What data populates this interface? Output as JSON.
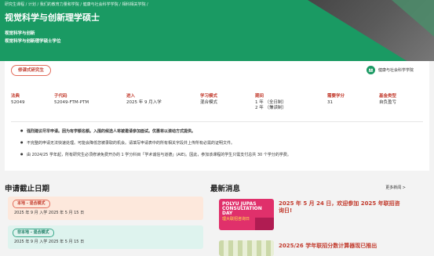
{
  "hero": {
    "breadcrumb": "研究生课程 / 计划 / 我们的教育力量和学院 / 健康与社会科学学院 / 相科相关学院 /",
    "title": "视觉科学与创新理学硕士",
    "subtitle_1": "视觉科学与创新",
    "subtitle_2": "视觉科学与创新理学硕士学位"
  },
  "card": {
    "tag_label": "修课式研究生",
    "faculty_label": "健康与社会科学学院",
    "info": [
      {
        "label": "法典",
        "value": "52049"
      },
      {
        "label": "子代码",
        "value": "52049-FTM-PTM"
      },
      {
        "label": "进入",
        "value": "2025 年 9 月入学"
      },
      {
        "label": "学习模式",
        "value": "混合模式"
      },
      {
        "label": "期间",
        "value": "1 年 （全日制）",
        "value2": "2 年 （兼读制）"
      },
      {
        "label": "需要学分",
        "value": "31"
      },
      {
        "label": "基金类型",
        "value": "自负盈亏"
      }
    ],
    "notes": [
      "强烈建议尽早申请。因为有学额名额。入围的候选人将被邀请参加面试。优惠将以滚动方式提供。",
      "不完整的申请无法快速处理。可能会降低您被录取的机会。请填写申请表中的所有相关字段并上传所有必需的证明文件。",
      "由 2024/25 学年起，所有研究生必须修读免费开办的 1 学分科目「学术诚信与道德」(AIE)。因此，参加该课程的学生只需支付总共 30 个学分的学费。"
    ]
  },
  "deadline": {
    "title": "申请截止日期",
    "cards": [
      {
        "pill": "本地 - 混合模式",
        "text": "2025 年 9 月 入学 2025 年 5 月 15 日"
      },
      {
        "pill": "非本地 - 混合模式",
        "text": "2025 年 9 月 入学 2025 年 5 月 15 日"
      }
    ]
  },
  "news": {
    "title": "最新消息",
    "more_label": "更多新闻 >",
    "items": [
      {
        "headline": "2025 年 5 月 24 日，欢迎参加 2025 年联招咨询日!",
        "img_text": "POLYU JUPAS CONSULTATION DAY",
        "img_sub": "理大联招咨询日"
      },
      {
        "headline": "2025/26 学年联招分数计算器现已推出",
        "img_text": ""
      }
    ]
  },
  "colors": {
    "brand_green": "#1a9a63",
    "accent_red": "#c23b2d"
  }
}
